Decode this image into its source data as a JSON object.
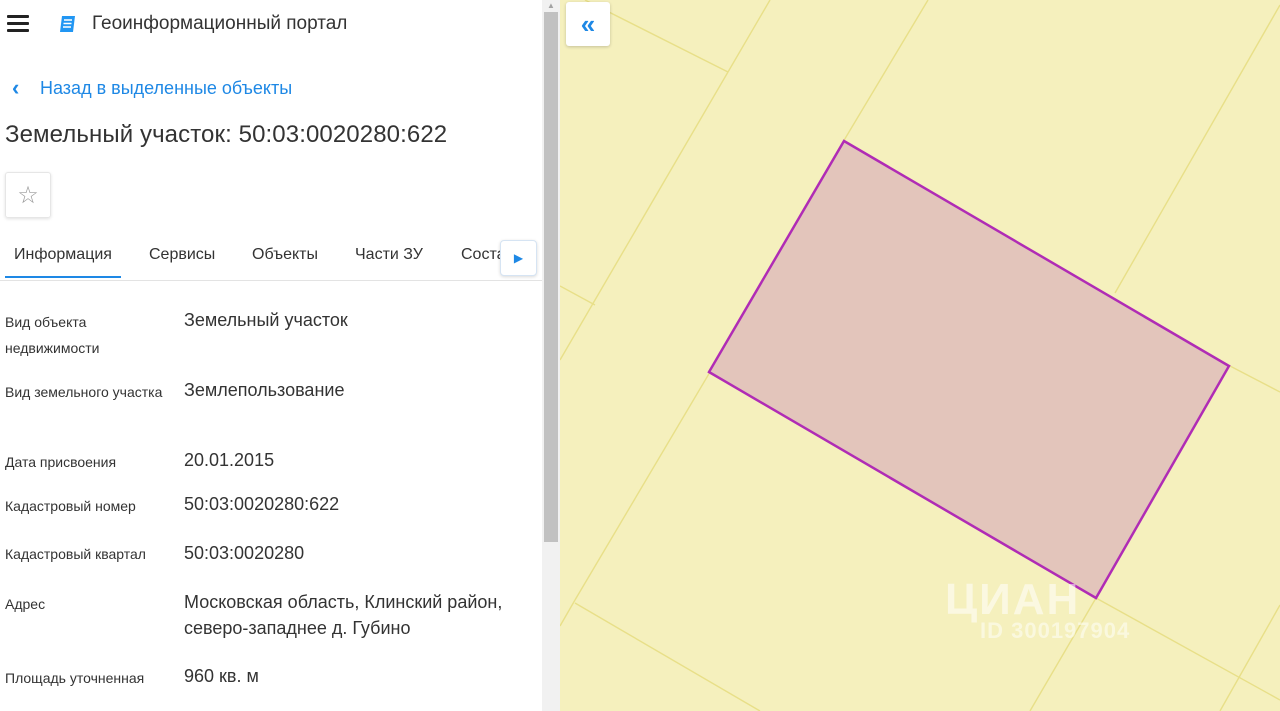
{
  "app": {
    "title": "Геоинформационный портал"
  },
  "nav": {
    "back_label": "Назад в выделенные объекты"
  },
  "object": {
    "title": "Земельный участок: 50:03:0020280:622"
  },
  "tabs": [
    {
      "label": "Информация",
      "active": true
    },
    {
      "label": "Сервисы"
    },
    {
      "label": "Объекты"
    },
    {
      "label": "Части ЗУ"
    },
    {
      "label": "Соста"
    }
  ],
  "info_rows": [
    {
      "label": "Вид объекта недвижимости",
      "value": "Земельный участок"
    },
    {
      "label": "Вид земельного участка",
      "value": "Землепользование"
    },
    {
      "label": "Дата присвоения",
      "value": "20.01.2015"
    },
    {
      "label": "Кадастровый номер",
      "value": "50:03:0020280:622"
    },
    {
      "label": "Кадастровый квартал",
      "value": "50:03:0020280"
    },
    {
      "label": "Адрес",
      "value": "Московская область, Клинский район, северо-западнее д. Губино"
    },
    {
      "label": "Площадь уточненная",
      "value": "960 кв. м"
    }
  ],
  "map": {
    "watermark": "ЦИАН",
    "watermark_id": "ID 300197904",
    "colors": {
      "background": "#f5f0bd",
      "parcel_fill": "#e3c5bb",
      "parcel_stroke": "#b02cb5",
      "lines": "#e8df88"
    }
  },
  "icons": {
    "menu": "hamburger-icon",
    "logo": "portal-logo-icon",
    "back": "chevron-left-icon",
    "favorite": "star-outline-icon",
    "tab_next": "caret-right-icon",
    "collapse": "double-chevron-left-icon"
  },
  "colors": {
    "accent": "#1e88e5",
    "text": "#333333"
  }
}
